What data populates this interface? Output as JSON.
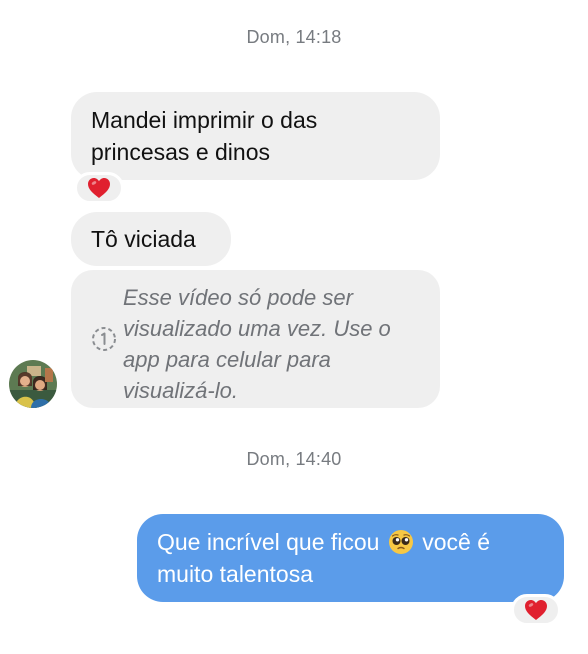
{
  "conversation": {
    "timestamp_1": "Dom, 14:18",
    "timestamp_2": "Dom, 14:40",
    "messages": [
      {
        "sender": "them",
        "text": "Mandei imprimir o das princesas e dinos",
        "reaction": "heart-emoji"
      },
      {
        "sender": "them",
        "text": "Tô viciada"
      },
      {
        "sender": "them",
        "type": "view-once-video",
        "text": "Esse vídeo só pode ser visualizado uma vez. Use o app para celular para visualizá-lo.",
        "icon": "view-once-icon"
      },
      {
        "sender": "me",
        "text_before_emoji": "Que incrível que ficou",
        "emoji": "pleading-face-emoji",
        "text_after_emoji": "você é muito talentosa",
        "reaction": "heart-emoji"
      }
    ]
  },
  "colors": {
    "incoming_bubble": "#efefef",
    "outgoing_bubble": "#5b9cea",
    "timestamp": "#777b80",
    "heart": "#e0202f"
  }
}
